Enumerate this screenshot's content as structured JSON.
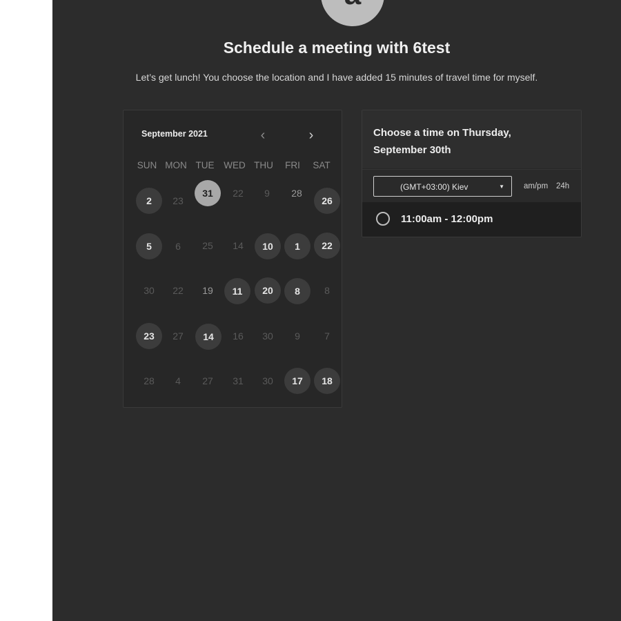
{
  "profile": {
    "avatar_initial": "a"
  },
  "header": {
    "title": "Schedule a meeting with 6test",
    "subtitle": "Let’s get lunch! You choose the location and I have added 15 minutes of travel time for myself."
  },
  "calendar": {
    "month_label": "September 2021",
    "prev_icon": "‹",
    "next_icon": "›",
    "weekdays": [
      "SUN",
      "MON",
      "TUE",
      "WED",
      "THU",
      "FRI",
      "SAT"
    ],
    "weeks": [
      [
        {
          "day": "2",
          "state": "available"
        },
        {
          "day": "23",
          "state": "disabled"
        },
        {
          "day": "31",
          "state": "selected"
        },
        {
          "day": "22",
          "state": "disabled"
        },
        {
          "day": "9",
          "state": "disabled"
        },
        {
          "day": "28",
          "state": "muted"
        },
        {
          "day": "26",
          "state": "available"
        }
      ],
      [
        {
          "day": "5",
          "state": "available"
        },
        {
          "day": "6",
          "state": "disabled"
        },
        {
          "day": "25",
          "state": "disabled"
        },
        {
          "day": "14",
          "state": "disabled"
        },
        {
          "day": "10",
          "state": "available"
        },
        {
          "day": "1",
          "state": "available"
        },
        {
          "day": "22",
          "state": "available"
        }
      ],
      [
        {
          "day": "30",
          "state": "disabled"
        },
        {
          "day": "22",
          "state": "disabled"
        },
        {
          "day": "19",
          "state": "muted"
        },
        {
          "day": "11",
          "state": "available"
        },
        {
          "day": "20",
          "state": "available"
        },
        {
          "day": "8",
          "state": "available"
        },
        {
          "day": "8",
          "state": "disabled"
        }
      ],
      [
        {
          "day": "23",
          "state": "available"
        },
        {
          "day": "27",
          "state": "disabled"
        },
        {
          "day": "14",
          "state": "available"
        },
        {
          "day": "16",
          "state": "disabled"
        },
        {
          "day": "30",
          "state": "disabled"
        },
        {
          "day": "9",
          "state": "disabled"
        },
        {
          "day": "7",
          "state": "disabled"
        }
      ],
      [
        {
          "day": "28",
          "state": "disabled"
        },
        {
          "day": "4",
          "state": "disabled"
        },
        {
          "day": "27",
          "state": "disabled"
        },
        {
          "day": "31",
          "state": "disabled"
        },
        {
          "day": "30",
          "state": "disabled"
        },
        {
          "day": "17",
          "state": "available"
        },
        {
          "day": "18",
          "state": "available"
        }
      ]
    ]
  },
  "time_picker": {
    "heading": "Choose a time on Thursday, September 30th",
    "timezone": "(GMT+03:00) Kiev",
    "timezone_caret": "▼",
    "format_ampm": "am/pm",
    "format_24h": "24h",
    "slots": [
      "11:00am - 12:00pm"
    ]
  },
  "colors": {
    "page_background": "#2c2c2c",
    "available_day": "#3c3c3c",
    "selected_day": "#a8a8a8"
  }
}
